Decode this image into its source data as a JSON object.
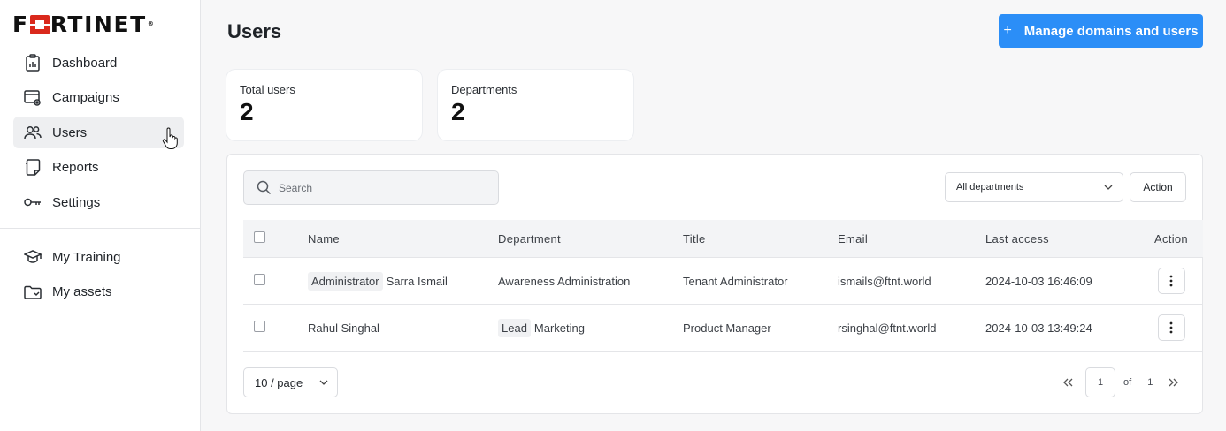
{
  "brand": {
    "logo_left": "F",
    "logo_right": "RTINET",
    "registered": "®",
    "accent": "#da291c"
  },
  "sidebar": {
    "items": [
      {
        "label": "Dashboard",
        "icon": "clipboard-chart-icon"
      },
      {
        "label": "Campaigns",
        "icon": "browser-gear-icon"
      },
      {
        "label": "Users",
        "icon": "users-icon",
        "active": true
      },
      {
        "label": "Reports",
        "icon": "report-icon"
      },
      {
        "label": "Settings",
        "icon": "key-icon"
      }
    ],
    "secondary": [
      {
        "label": "My Training",
        "icon": "graduation-cap-icon"
      },
      {
        "label": "My assets",
        "icon": "folder-icon"
      }
    ]
  },
  "header": {
    "title": "Users",
    "primary_button": "Manage domains and users",
    "primary_color": "#2b8ef7"
  },
  "stats": [
    {
      "label": "Total users",
      "value": "2"
    },
    {
      "label": "Departments",
      "value": "2"
    }
  ],
  "toolbar": {
    "search_placeholder": "Search",
    "department_filter": "All departments",
    "action_label": "Action"
  },
  "table": {
    "columns": [
      "Name",
      "Department",
      "Title",
      "Email",
      "Last access",
      "Action"
    ],
    "rows": [
      {
        "name_tag": "Administrator",
        "name": "Sarra Ismail",
        "dept_tag": "",
        "department": "Awareness Administration",
        "title": "Tenant Administrator",
        "email": "ismails@ftnt.world",
        "last_access": "2024-10-03 16:46:09"
      },
      {
        "name_tag": "",
        "name": "Rahul Singhal",
        "dept_tag": "Lead",
        "department": "Marketing",
        "title": "Product Manager",
        "email": "rsinghal@ftnt.world",
        "last_access": "2024-10-03 13:49:24"
      }
    ]
  },
  "pagination": {
    "page_size": "10 / page",
    "current_page": "1",
    "of_label": "of",
    "total_pages": "1"
  }
}
